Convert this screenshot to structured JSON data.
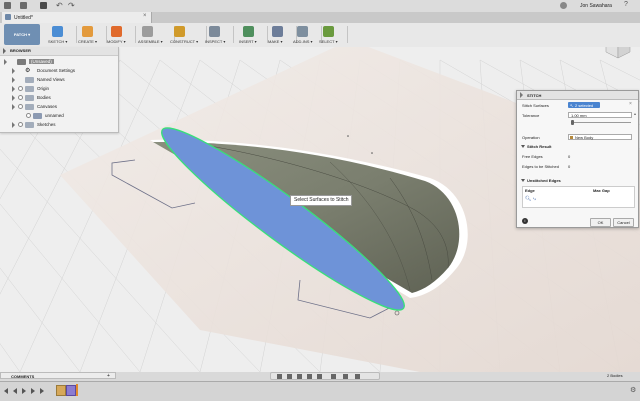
{
  "user": {
    "name": "Jon Sawahara"
  },
  "tab": {
    "title": "Untitled*"
  },
  "mode": {
    "label": "PATCH ▾"
  },
  "ribbon": [
    {
      "label": "SKETCH ▾",
      "color": "#4b8dd4",
      "icon": "sketch-icon"
    },
    {
      "label": "CREATE ▾",
      "color": "#e39a3c",
      "icon": "create-icon"
    },
    {
      "label": "MODIFY ▾",
      "color": "#e06a2c",
      "icon": "modify-icon"
    },
    {
      "label": "ASSEMBLE ▾",
      "color": "#9c9c9c",
      "icon": "assemble-icon"
    },
    {
      "label": "CONSTRUCT ▾",
      "color": "#d09a2a",
      "icon": "construct-icon"
    },
    {
      "label": "INSPECT ▾",
      "color": "#7c8a9a",
      "icon": "inspect-icon"
    },
    {
      "label": "INSERT ▾",
      "color": "#4f8f5d",
      "icon": "insert-icon"
    },
    {
      "label": "MAKE ▾",
      "color": "#6d7d99",
      "icon": "make-icon"
    },
    {
      "label": "ADD-INS ▾",
      "color": "#7e8f9f",
      "icon": "add-ins-icon"
    },
    {
      "label": "SELECT ▾",
      "color": "#6a9a3e",
      "icon": "select-icon"
    }
  ],
  "browser": {
    "title": "BROWSER",
    "items": [
      {
        "label": "(Unsaved)",
        "indent": 0,
        "tri": true,
        "eye": false,
        "folder": true,
        "highlight": true
      },
      {
        "label": "Document Settings",
        "indent": 1,
        "tri": true,
        "eye": false,
        "folder": false,
        "gear": true
      },
      {
        "label": "Named Views",
        "indent": 1,
        "tri": true,
        "eye": false,
        "folder": true
      },
      {
        "label": "Origin",
        "indent": 1,
        "tri": true,
        "eye": true,
        "folder": true
      },
      {
        "label": "Bodies",
        "indent": 1,
        "tri": true,
        "eye": true,
        "folder": true
      },
      {
        "label": "Canvases",
        "indent": 1,
        "tri": true,
        "eye": true,
        "folder": true
      },
      {
        "label": "unnamed",
        "indent": 2,
        "tri": false,
        "eye": true,
        "folder": false,
        "chip": true
      },
      {
        "label": "Sketches",
        "indent": 1,
        "tri": true,
        "eye": true,
        "folder": true
      }
    ]
  },
  "stitch": {
    "title": "STITCH",
    "stitch_surfaces_label": "Stitch Surfaces",
    "selected_value": "2 selected",
    "tolerance_label": "Tolerance",
    "tolerance_value": "1.00 mm",
    "operation_label": "Operation",
    "operation_value": "New Body",
    "result_header": "Stitch Result",
    "free_edges_label": "Free Edges",
    "free_edges_value": "0",
    "edges_to_stitch_label": "Edges to be Stitched",
    "edges_to_stitch_value": "0",
    "unstitched_header": "Unstitched Edges",
    "col_edge": "Edge",
    "col_max_gap": "Max Gap",
    "ok": "OK",
    "cancel": "Cancel"
  },
  "tooltip": "Select Surfaces to Stitch",
  "comments": {
    "label": "COMMENTS"
  },
  "status": {
    "selection": "2 Bodies"
  }
}
